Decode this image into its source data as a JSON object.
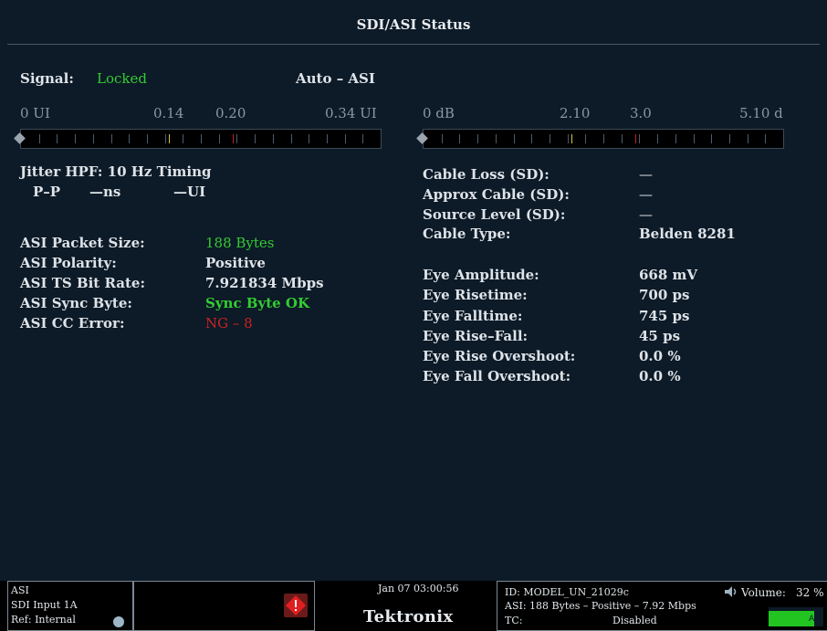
{
  "title": "SDI/ASI Status",
  "signal": {
    "label": "Signal:",
    "value": "Locked",
    "mode": "Auto – ASI"
  },
  "jitter_meter": {
    "scale": [
      "0 UI",
      "0.14",
      "0.20",
      "0.34 UI"
    ],
    "yellow_mark": 0.14,
    "red_mark": 0.2,
    "max": 0.34,
    "reading": 0
  },
  "cable_meter": {
    "scale": [
      "0 dB",
      "2.10",
      "3.0",
      "5.10 d"
    ],
    "yellow_mark": 2.1,
    "red_mark": 3.0,
    "max": 5.1,
    "reading": 0
  },
  "jitter": {
    "heading": "Jitter HPF: 10 Hz Timing",
    "pp_label": "P–P",
    "ns_value": "—ns",
    "ui_value": "—UI"
  },
  "asi": {
    "rows": [
      {
        "label": "ASI Packet Size:",
        "value": "188 Bytes",
        "color": "#33cc33"
      },
      {
        "label": "ASI Polarity:",
        "value": "Positive",
        "color": "#dde3e8"
      },
      {
        "label": "ASI TS Bit Rate:",
        "value": "7.921834 Mbps",
        "color": "#dde3e8"
      },
      {
        "label": "ASI Sync Byte:",
        "value": "Sync Byte OK",
        "color": "#33cc33"
      },
      {
        "label": "ASI CC Error:",
        "value": "NG – 8",
        "color": "#cc2222"
      }
    ]
  },
  "cable": {
    "rows": [
      {
        "label": "Cable Loss (SD):",
        "value": "—"
      },
      {
        "label": "Approx Cable (SD):",
        "value": "—"
      },
      {
        "label": "Source Level (SD):",
        "value": "—"
      },
      {
        "label": "Cable Type:",
        "value": "Belden 8281"
      }
    ]
  },
  "eye": {
    "rows": [
      {
        "label": "Eye Amplitude:",
        "value": "668 mV"
      },
      {
        "label": "Eye Risetime:",
        "value": "700 ps"
      },
      {
        "label": "Eye Falltime:",
        "value": "745 ps"
      },
      {
        "label": "Eye Rise–Fall:",
        "value": "45 ps"
      },
      {
        "label": "Eye Rise Overshoot:",
        "value": "0.0 %"
      },
      {
        "label": "Eye Fall Overshoot:",
        "value": "0.0 %"
      }
    ]
  },
  "statusbar": {
    "format": "ASI",
    "input": "SDI Input 1A",
    "ref": "Ref: Internal",
    "datetime": "Jan 07 03:00:56",
    "brand": "Tektronix",
    "id": "ID: MODEL_UN_21029c",
    "asi_summary": "ASI: 188 Bytes – Positive – 7.92 Mbps",
    "tc_label": "TC:",
    "tc_value": "Disabled",
    "volume_label": "Volume:",
    "volume_value": "32 %",
    "volume_level": 0.32,
    "ac_label": "AC"
  },
  "icons": [
    "speaker-icon",
    "warning-icon",
    "status-indicator-icon"
  ]
}
